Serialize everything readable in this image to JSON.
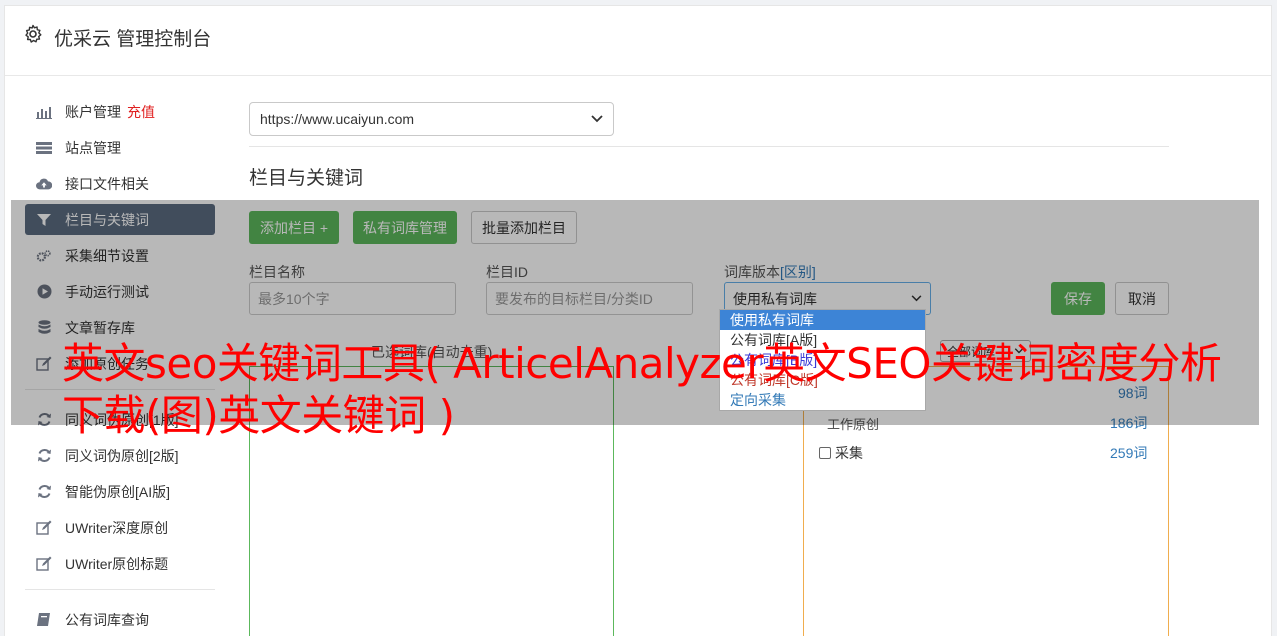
{
  "header": {
    "title": "优采云 管理控制台"
  },
  "sidebar": {
    "items": [
      {
        "label": "账户管理",
        "extra": "充值",
        "icon": "bar-chart-icon"
      },
      {
        "label": "站点管理",
        "icon": "server-icon"
      },
      {
        "label": "接口文件相关",
        "icon": "cloud-upload-icon"
      },
      {
        "label": "栏目与关键词",
        "icon": "filter-icon"
      },
      {
        "label": "采集细节设置",
        "icon": "gears-icon"
      },
      {
        "label": "手动运行测试",
        "icon": "play-circle-icon"
      },
      {
        "label": "文章暂存库",
        "icon": "database-icon"
      },
      {
        "label": "添加原创任务",
        "icon": "edit-icon"
      },
      {
        "label": "同义词伪原创[1版]",
        "icon": "refresh-icon"
      },
      {
        "label": "同义词伪原创[2版]",
        "icon": "refresh-icon"
      },
      {
        "label": "智能伪原创[AI版]",
        "icon": "refresh-icon"
      },
      {
        "label": "UWriter深度原创",
        "icon": "edit-icon"
      },
      {
        "label": "UWriter原创标题",
        "icon": "edit-icon"
      },
      {
        "label": "公有词库查询",
        "icon": "book-icon"
      }
    ]
  },
  "site_select": {
    "value": "https://www.ucaiyun.com"
  },
  "section": {
    "title": "栏目与关键词"
  },
  "buttons": {
    "add_column": "添加栏目 +",
    "private_lib": "私有词库管理",
    "batch_add": "批量添加栏目",
    "save": "保存",
    "cancel": "取消"
  },
  "form": {
    "column_name_label": "栏目名称",
    "column_name_placeholder": "最多10个字",
    "column_id_label": "栏目ID",
    "column_id_placeholder": "要发布的目标栏目/分类ID",
    "lib_version_label": "词库版本",
    "lib_version_link": "[区别]",
    "lib_version_value": "使用私有词库"
  },
  "dropdown": {
    "options": [
      "使用私有词库",
      "公有词库[A版]",
      "公有词库[B版]",
      "公有词库[C版]",
      "定向采集"
    ],
    "colors": [
      "#ffffff",
      "#333333",
      "#3b3bd6",
      "#c0392b",
      "#337ab7"
    ]
  },
  "keywords": {
    "selected_label": "已选词库(自动去重)",
    "all_libs": "全部词库",
    "counts": [
      "98词",
      "186词",
      "259词"
    ],
    "collect_label": "采集",
    "right_label": "工作原创"
  },
  "watermark": "英文seo关键词工具( ArticelAnalyzer英文SEO关键词密度分析下载(图)英文关键词 )",
  "colors": {
    "accent_green": "#5cb85c",
    "active_nav": "#5b6b80",
    "link_blue": "#337ab7",
    "warning_red": "#e02020"
  }
}
